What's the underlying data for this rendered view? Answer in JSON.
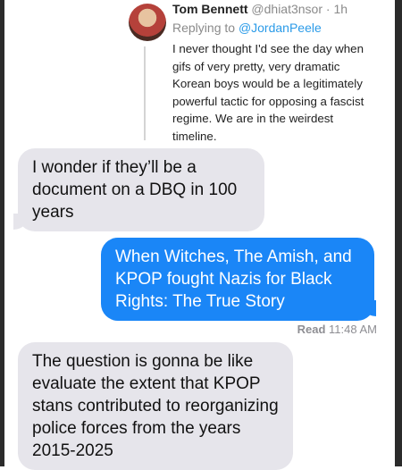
{
  "tweet": {
    "author_name": "Tom Bennett",
    "author_handle": "@dhiat3nsor",
    "time": "1h",
    "replying_prefix": "Replying to",
    "replying_to": "@JordanPeele",
    "text": "I never thought I'd see the day when gifs of very pretty, very dramatic Korean boys would be a legitimately powerful tactic for opposing a fascist regime. We are in the weirdest timeline."
  },
  "messages": [
    {
      "direction": "received",
      "text": "I wonder if they’ll be a document on a DBQ in 100 years"
    },
    {
      "direction": "sent",
      "text": "When Witches, The Amish, and KPOP fought Nazis for Black Rights: The True Story"
    },
    {
      "direction": "received",
      "text": "The question is gonna be like evaluate the extent that KPOP stans contributed to reorganizing police forces from the years 2015-2025"
    }
  ],
  "receipt": {
    "label": "Read",
    "time": "11:48 AM"
  },
  "colors": {
    "sent_bubble": "#1a86f7",
    "received_bubble": "#e6e5eb",
    "link": "#2b9be8"
  }
}
